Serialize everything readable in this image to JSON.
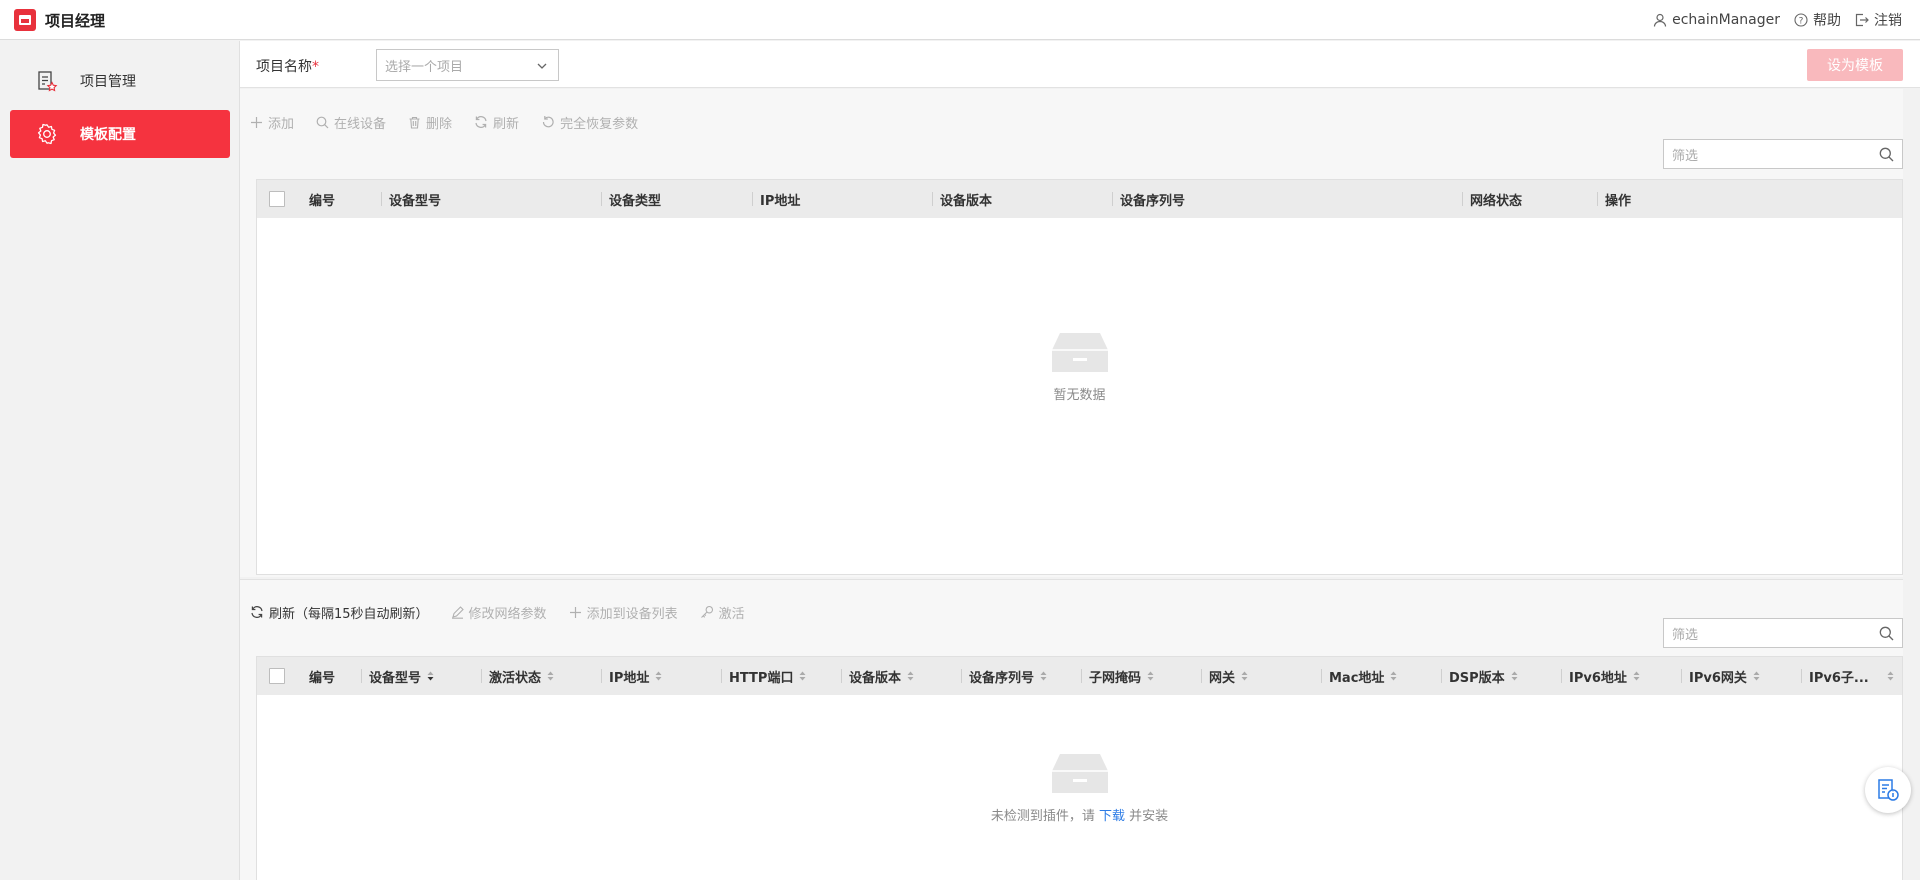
{
  "header": {
    "app_title": "项目经理",
    "user_name": "echainManager",
    "help_label": "帮助",
    "logout_label": "注销"
  },
  "sidebar": {
    "items": [
      {
        "label": "项目管理",
        "icon": "project-list-icon",
        "active": false
      },
      {
        "label": "模板配置",
        "icon": "gear-icon",
        "active": true
      }
    ]
  },
  "project_bar": {
    "label": "项目名称",
    "required_mark": "*",
    "select_placeholder": "选择一个项目",
    "set_template_label": "设为模板"
  },
  "device_panel": {
    "toolbar": {
      "add": "添加",
      "online_devices": "在线设备",
      "delete": "删除",
      "refresh": "刷新",
      "restore_defaults": "完全恢复参数"
    },
    "filter_placeholder": "筛选",
    "columns": [
      "编号",
      "设备型号",
      "设备类型",
      "IP地址",
      "设备版本",
      "设备序列号",
      "网络状态",
      "操作"
    ],
    "rows": [],
    "empty_text": "暂无数据"
  },
  "online_panel": {
    "toolbar": {
      "refresh": "刷新（每隔15秒自动刷新）",
      "modify_network": "修改网络参数",
      "add_to_list": "添加到设备列表",
      "activate": "激活"
    },
    "filter_placeholder": "筛选",
    "columns": [
      "编号",
      "设备型号",
      "激活状态",
      "IP地址",
      "HTTP端口",
      "设备版本",
      "设备序列号",
      "子网掩码",
      "网关",
      "Mac地址",
      "DSP版本",
      "IPv6地址",
      "IPv6网关",
      "IPv6子..."
    ],
    "rows": [],
    "empty_text_before": "未检测到插件，请 ",
    "empty_link": "下载",
    "empty_text_after": " 并安装"
  },
  "colors": {
    "accent": "#f5333f",
    "accent_disabled": "#f9b9bd",
    "link": "#2c7be5"
  }
}
